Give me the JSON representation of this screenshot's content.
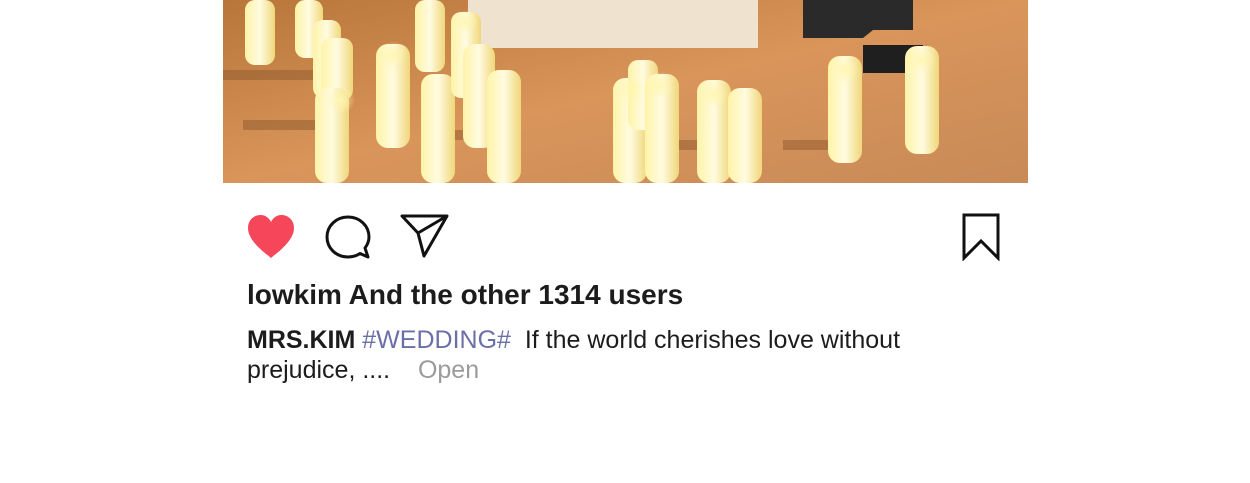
{
  "post": {
    "image_label": "candle-photo",
    "likes_text": "lowkim And the other 1314 users",
    "caption": {
      "author": "MRS.KIM",
      "hashtag": "#WEDDING#",
      "text_line1": "If the world cherishes love without",
      "text_line2": "prejudice, ....",
      "more_label": "Open"
    }
  },
  "actions": {
    "like_icon": "heart-filled-icon",
    "comment_icon": "comment-icon",
    "share_icon": "send-icon",
    "save_icon": "bookmark-icon"
  },
  "colors": {
    "like": "#f5465a",
    "hashtag": "#6a6fa8",
    "muted": "#9b9b9b",
    "text": "#1c1c1c"
  }
}
